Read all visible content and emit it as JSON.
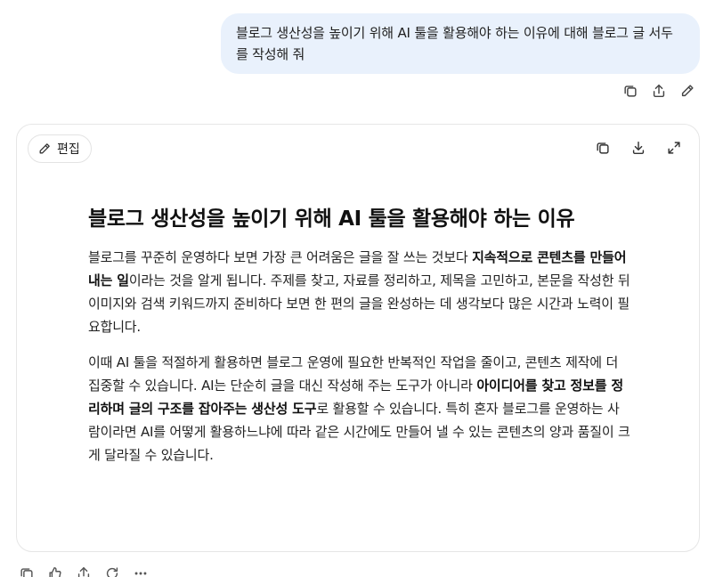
{
  "user_message": {
    "text": "블로그 생산성을 높이기 위해 AI 툴을 활용해야 하는 이유에 대해 블로그 글 서두를 작성해 줘"
  },
  "message_actions": [
    {
      "icon": "copy-icon"
    },
    {
      "icon": "share-icon"
    },
    {
      "icon": "edit-pencil-icon"
    }
  ],
  "document": {
    "edit_label": "편집",
    "toolbar_icons": [
      "copy-icon",
      "download-icon",
      "expand-icon"
    ],
    "title": "블로그 생산성을 높이기 위해 AI 툴을 활용해야 하는 이유",
    "para1": {
      "t1": "블로그를 꾸준히 운영하다 보면 가장 큰 어려움은 글을 잘 쓰는 것보다 ",
      "b1": "지속적으로 콘텐츠를 만들어 내는 일",
      "t2": "이라는 것을 알게 됩니다. 주제를 찾고, 자료를 정리하고, 제목을 고민하고, 본문을 작성한 뒤 이미지와 검색 키워드까지 준비하다 보면 한 편의 글을 완성하는 데 생각보다 많은 시간과 노력이 필요합니다."
    },
    "para2": {
      "t1": "이때 AI 툴을 적절하게 활용하면 블로그 운영에 필요한 반복적인 작업을 줄이고, 콘텐츠 제작에 더 집중할 수 있습니다. AI는 단순히 글을 대신 작성해 주는 도구가 아니라 ",
      "b1": "아이디어를 찾고 정보를 정리하며 글의 구조를 잡아주는 생산성 도구",
      "t2": "로 활용할 수 있습니다. 특히 혼자 블로그를 운영하는 사람이라면 AI를 어떻게 활용하느냐에 따라 같은 시간에도 만들어 낼 수 있는 콘텐츠의 양과 품질이 크게 달라질 수 있습니다."
    }
  },
  "response_actions": [
    "copy-icon",
    "thumbs-up-icon",
    "share-icon",
    "regenerate-icon",
    "more-icon"
  ]
}
